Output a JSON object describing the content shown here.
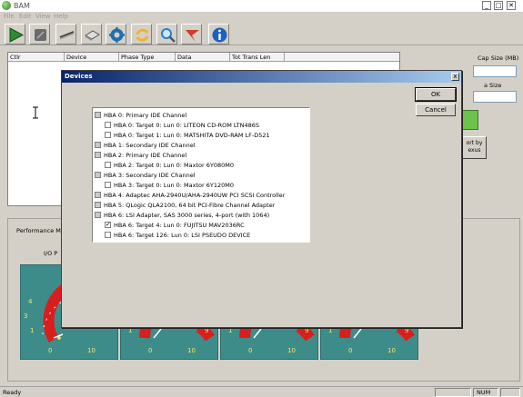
{
  "app": {
    "title": "BAM",
    "minimize": "_",
    "maximize": "□",
    "close": "✕"
  },
  "menu": [
    "File",
    "Edit",
    "View",
    "Help"
  ],
  "toolbar": {
    "buttons": [
      {
        "icon": "play-icon",
        "color": "#2e8b2e"
      },
      {
        "icon": "stop-icon",
        "color": "#555555"
      },
      {
        "icon": "cable-icon",
        "color": "#444444"
      },
      {
        "icon": "disk-icon",
        "color": "#666666"
      },
      {
        "icon": "gear-icon",
        "color": "#1f6fb0"
      },
      {
        "icon": "refresh-icon",
        "color": "#f0b428"
      },
      {
        "icon": "search-icon",
        "color": "#2a7fd0"
      },
      {
        "icon": "flag-icon",
        "color": "#d23c2c"
      },
      {
        "icon": "info-icon",
        "color": "#1f5fbf"
      }
    ]
  },
  "grid": {
    "columns": [
      "Ctlr",
      "Device",
      "Phase Type",
      "Data",
      "Tot Trans Len"
    ]
  },
  "right_panel": {
    "cap_size_label": "Cap Size (MB)",
    "size_label": "a Size",
    "sort_button": "ort by\nexus"
  },
  "performance": {
    "label": "Performance Mo",
    "io_label": "I/O P"
  },
  "gauges": {
    "tick_labels": [
      "0",
      "1",
      "3",
      "4",
      "9",
      "10"
    ]
  },
  "status": {
    "text": "Ready",
    "num": "NUM"
  },
  "dialog": {
    "title": "Devices",
    "ok": "OK",
    "cancel": "Cancel",
    "close": "x",
    "items": [
      {
        "level": 0,
        "state": "grey",
        "label": "HBA 0: Primary IDE Channel"
      },
      {
        "level": 1,
        "state": "empty",
        "label": "HBA 0: Target 0: Lun 0:  LITEON CD-ROM LTN486S"
      },
      {
        "level": 1,
        "state": "empty",
        "label": "HBA 0: Target 1: Lun 0:  MATSHITA DVD-RAM LF-D521"
      },
      {
        "level": 0,
        "state": "grey",
        "label": "HBA 1: Secondary IDE Channel"
      },
      {
        "level": 0,
        "state": "grey",
        "label": "HBA 2: Primary IDE Channel"
      },
      {
        "level": 1,
        "state": "empty",
        "label": "HBA 2: Target 0: Lun 0:  Maxtor 6Y080M0"
      },
      {
        "level": 0,
        "state": "grey",
        "label": "HBA 3: Secondary IDE Channel"
      },
      {
        "level": 1,
        "state": "empty",
        "label": "HBA 3: Target 0: Lun 0:  Maxtor 6Y120M0"
      },
      {
        "level": 0,
        "state": "grey",
        "label": "HBA 4: Adaptec AHA-2940U/AHA-2940UW PCI SCSI Controller"
      },
      {
        "level": 0,
        "state": "grey",
        "label": "HBA 5: QLogic QLA2100, 64 bit PCI-Fibre Channel Adapter"
      },
      {
        "level": 0,
        "state": "grey",
        "label": "HBA 6: LSI Adapter, SAS 3000 series, 4-port (with 1064)"
      },
      {
        "level": 1,
        "state": "checked",
        "label": "HBA 6: Target 4: Lun 0: FUJITSU MAV2036RC"
      },
      {
        "level": 1,
        "state": "empty",
        "label": "HBA 6: Target 126: Lun 0: LSI PSEUDO DEVICE"
      }
    ]
  }
}
